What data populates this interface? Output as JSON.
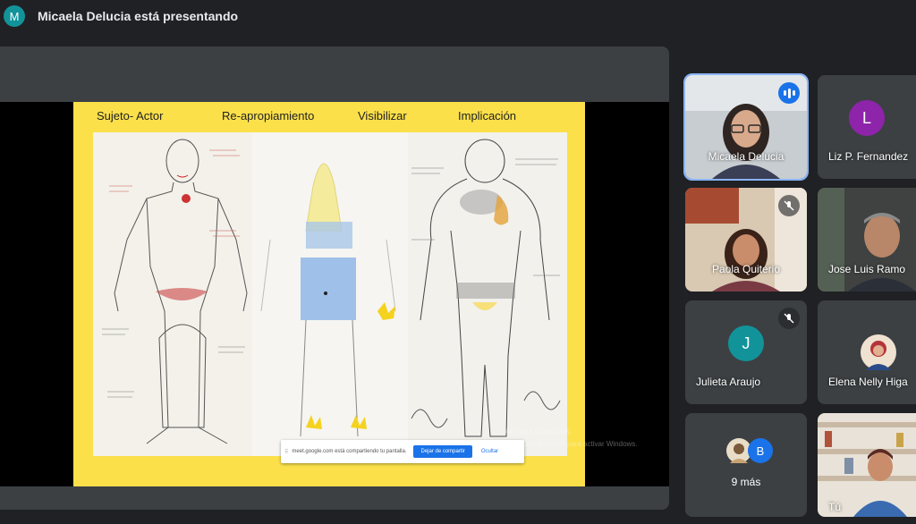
{
  "presenter_bar": {
    "initial": "M",
    "title": "Micaela Delucia está presentando"
  },
  "slide": {
    "headings": [
      "Sujeto- Actor",
      "Re-apropiamiento",
      "Visibilizar",
      "Implicación"
    ]
  },
  "share_bar": {
    "message": "meet.google.com está compartiendo tu pantalla.",
    "stop_label": "Dejar de compartir",
    "hide_label": "Ocultar"
  },
  "watermark": {
    "line1": "Activar Windows",
    "line2": "Ve a Configuración para activar Windows."
  },
  "participants": [
    {
      "name": "Micaela Delucia",
      "type": "video",
      "speaking": true
    },
    {
      "name": "Liz P. Fernandez",
      "type": "letter",
      "initial": "L",
      "color": "#8e24aa"
    },
    {
      "name": "Paola Quiterio",
      "type": "video",
      "muted": true
    },
    {
      "name": "Jose Luis Ramo",
      "type": "video"
    },
    {
      "name": "Julieta Araujo",
      "type": "letter",
      "initial": "J",
      "color": "#12939a",
      "muted": true
    },
    {
      "name": "Elena Nelly Higa",
      "type": "photo"
    },
    {
      "more_label": "9 más",
      "initial": "B",
      "color": "#1a73e8"
    },
    {
      "name": "Tú",
      "type": "video"
    }
  ]
}
